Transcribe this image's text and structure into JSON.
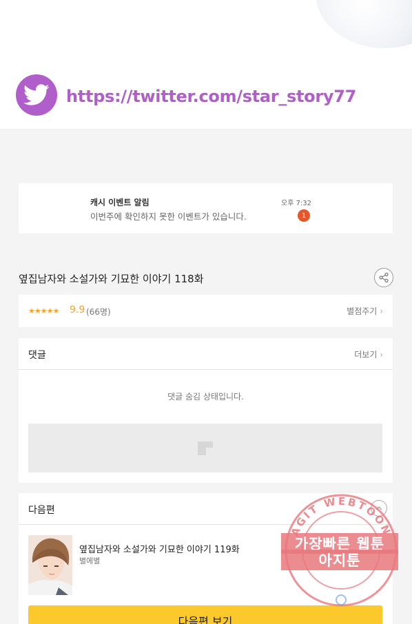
{
  "banner": {
    "twitter_url": "https://twitter.com/star_story77",
    "icon": "twitter-bird-icon",
    "accent_color": "#b05ec9"
  },
  "notification": {
    "title": "캐시 이벤트 알림",
    "message": "이번주에 확인하지 못한 이벤트가 있습니다.",
    "time": "오후 7:32",
    "badge_count": "1"
  },
  "episode": {
    "title": "옆집남자와 소설가와 기묘한 이야기 118화",
    "share_icon": "share-icon"
  },
  "rating": {
    "stars": "★★★★★",
    "score": "9.9",
    "count": "(66명)",
    "rate_label": "별점주기",
    "star_color": "#f5a623"
  },
  "comments": {
    "title": "댓글",
    "more_label": "더보기",
    "hidden_message": "댓글 숨김 상태입니다."
  },
  "next_episode": {
    "section_title": "다음편",
    "title": "옆집남자와 소설가와 기묘한 이야기 119화",
    "author": "별에별",
    "button_label": "다음편 보기",
    "button_color": "#fcc92d"
  },
  "watermark": {
    "ring_text": "AGIT WEBTOON",
    "line1": "가장빠른 웹툰",
    "line2": "아지툰"
  }
}
